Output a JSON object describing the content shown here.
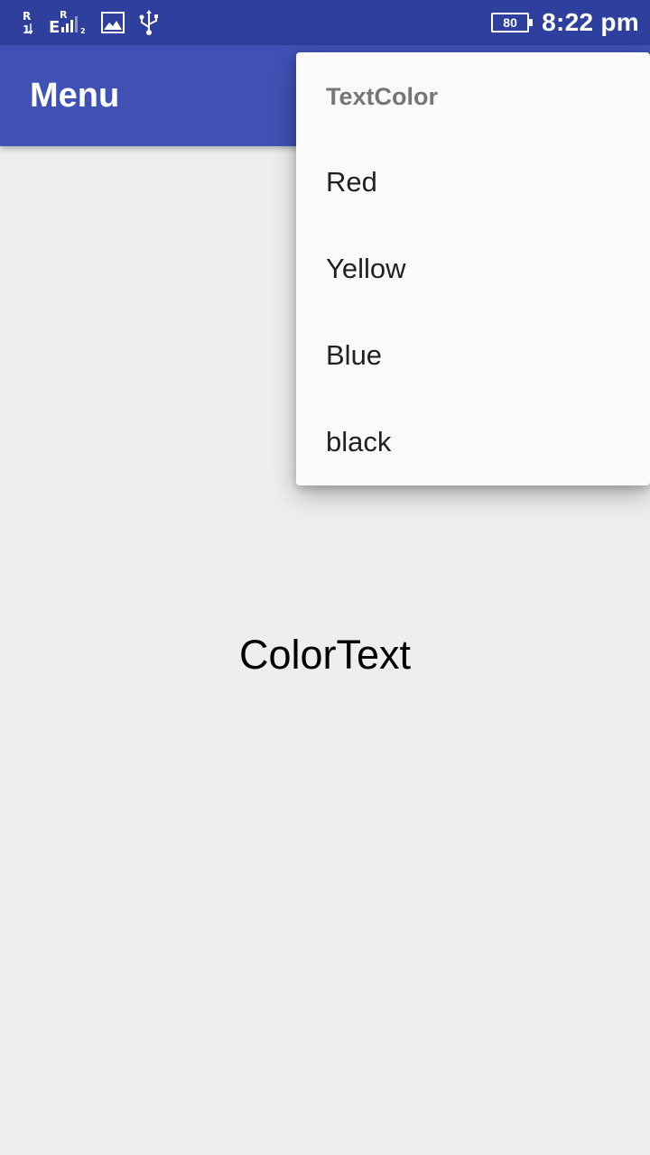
{
  "status_bar": {
    "sim1": {
      "letter": "R",
      "num": "1"
    },
    "sim2": {
      "letter": "E",
      "roaming": "R",
      "num": "2"
    },
    "icons": [
      "sim1-signal-icon",
      "sim2-signal-icon",
      "image-notification-icon",
      "usb-icon"
    ],
    "battery_level": "80",
    "time": "8:22 pm"
  },
  "app_bar": {
    "title": "Menu"
  },
  "popup_menu": {
    "header": "TextColor",
    "items": [
      {
        "label": "Red"
      },
      {
        "label": "Yellow"
      },
      {
        "label": "Blue"
      },
      {
        "label": "black"
      }
    ]
  },
  "main": {
    "text": "ColorText"
  },
  "colors": {
    "status_bar": "#2F3F9E",
    "app_bar": "#3F51B5",
    "background": "#EEEEEE",
    "menu_background": "#FAFAFA",
    "menu_header_text": "#757575",
    "menu_item_text": "#212121"
  }
}
